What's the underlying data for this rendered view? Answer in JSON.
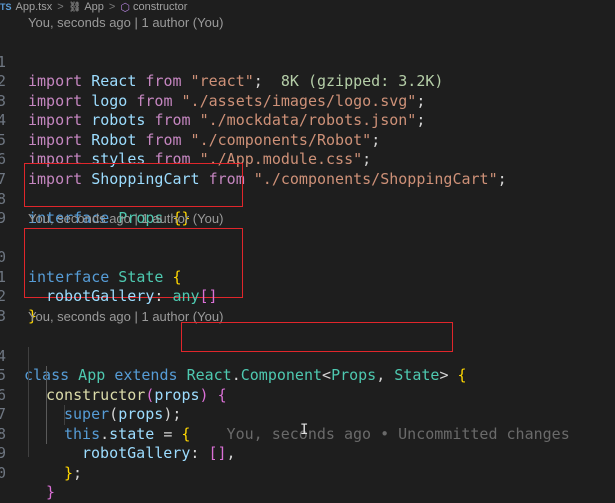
{
  "breadcrumb": {
    "file_badge": "TS",
    "file": "App.tsx",
    "sep": ">",
    "class_name": "App",
    "member": "constructor"
  },
  "codelens": {
    "top": "You, seconds ago | 1 author (You)",
    "state": "You, seconds ago | 1 author (You)",
    "app": "You, seconds ago | 1 author (You)"
  },
  "lines": {
    "l1": {
      "num": "1",
      "t1": "import",
      "t2": " React ",
      "t3": "from",
      "t4": " \"react\"",
      "t5": ";",
      "hint": "  8K (gzipped: 3.2K)"
    },
    "l2": {
      "num": "2",
      "t1": "import",
      "t2": " logo ",
      "t3": "from",
      "t4": " \"./assets/images/logo.svg\"",
      "t5": ";"
    },
    "l3": {
      "num": "3",
      "t1": "import",
      "t2": " robots ",
      "t3": "from",
      "t4": " \"./mockdata/robots.json\"",
      "t5": ";"
    },
    "l4": {
      "num": "4",
      "t1": "import",
      "t2": " Robot ",
      "t3": "from",
      "t4": " \"./components/Robot\"",
      "t5": ";"
    },
    "l5": {
      "num": "5",
      "t1": "import",
      "t2": " styles ",
      "t3": "from",
      "t4": " \"./App.module.css\"",
      "t5": ";"
    },
    "l6": {
      "num": "6",
      "t1": "import",
      "t2": " ShoppingCart ",
      "t3": "from",
      "t4": " \"./components/ShoppingCart\"",
      "t5": ";"
    },
    "l7": {
      "num": "7"
    },
    "l8": {
      "num": "8",
      "kw": "interface",
      "name": " Props ",
      "braces": "{}"
    },
    "l9": {
      "num": "9"
    },
    "l10": {
      "num": "0",
      "kw": "interface",
      "name": " State ",
      "brace": "{"
    },
    "l11": {
      "num": "1",
      "prop": "robotGallery",
      "colon": ": ",
      "type": "any",
      "arr": "[]"
    },
    "l12": {
      "num": "2",
      "brace": "}"
    },
    "l13": {
      "num": "3"
    },
    "l14": {
      "num": "4",
      "kw": "class",
      "name": " App ",
      "kw2": "extends",
      "sp": " ",
      "react": "React",
      "dot": ".",
      "comp": "Component",
      "lt": "<",
      "p": "Props",
      "comma": ", ",
      "s": "State",
      "gt": ">",
      "sp2": " ",
      "brace": "{"
    },
    "l15": {
      "num": "5",
      "fn": "constructor",
      "paren_open": "(",
      "arg": "props",
      "paren_close": ") ",
      "brace": "{"
    },
    "l16": {
      "num": "6",
      "fn": "super",
      "p1": "(",
      "arg": "props",
      "p2": ");"
    },
    "l17": {
      "num": "7",
      "kw": "this",
      "dot": ".",
      "prop": "state",
      "eq": " = ",
      "brace": "{",
      "ghost": "    You, seconds ago • Uncommitted changes"
    },
    "l18": {
      "num": "8",
      "prop": "robotGallery",
      "colon": ": ",
      "arr": "[]",
      "comma": ","
    },
    "l19": {
      "num": "9",
      "brace": "}",
      "semi": ";"
    },
    "l20": {
      "num": "0",
      "brace": "}"
    }
  },
  "colors": {
    "highlight_box": "#e0262b"
  },
  "icons": {
    "crumb_class": "class-icon",
    "crumb_method": "cube-icon",
    "mouse_cursor": "text-cursor-icon"
  }
}
